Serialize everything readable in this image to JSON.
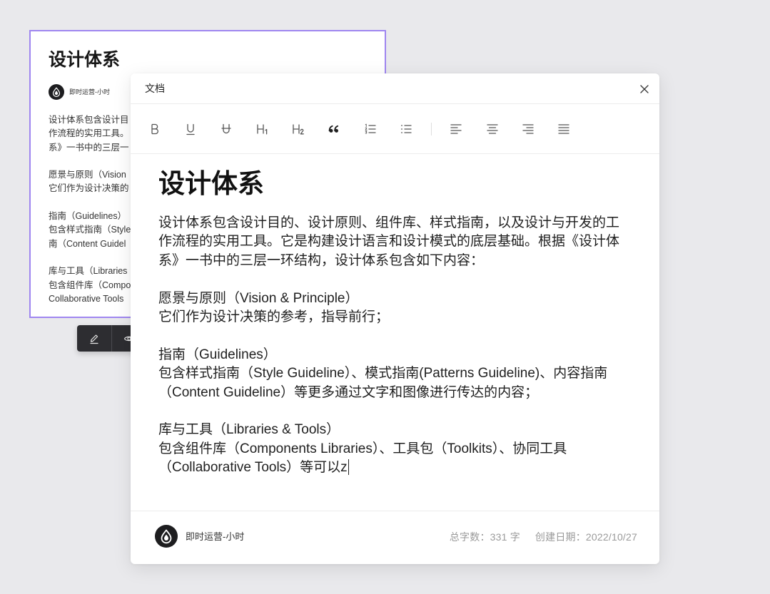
{
  "background_card": {
    "title": "设计体系",
    "author": "即时运营-小时",
    "avatar_icon": "droplet-logo-icon",
    "paragraphs": [
      [
        "设计体系包含设计目",
        "作流程的实用工具。",
        "系》一书中的三层一"
      ],
      [
        "愿景与原则（Vision",
        "它们作为设计决策的"
      ],
      [
        "指南（Guidelines）",
        "包含样式指南（Style",
        "南（Content Guidel"
      ],
      [
        "库与工具（Libraries",
        "包含组件库（Compo",
        "Collaborative Tools"
      ]
    ],
    "actions": [
      {
        "icon": "pencil-icon"
      },
      {
        "icon": "eye-icon"
      }
    ]
  },
  "modal": {
    "title": "文档",
    "close_icon": "close-icon",
    "toolbar": [
      {
        "icon": "bold-icon"
      },
      {
        "icon": "underline-icon"
      },
      {
        "icon": "strikethrough-icon"
      },
      {
        "icon": "heading-1-icon"
      },
      {
        "icon": "heading-2-icon"
      },
      {
        "icon": "blockquote-icon"
      },
      {
        "icon": "ordered-list-icon"
      },
      {
        "icon": "unordered-list-icon"
      },
      {
        "icon": "align-left-icon"
      },
      {
        "icon": "align-center-icon"
      },
      {
        "icon": "align-right-icon"
      },
      {
        "icon": "align-justify-icon"
      }
    ],
    "document": {
      "title": "设计体系",
      "paragraphs": [
        [
          "设计体系包含设计目的、设计原则、组件库、样式指南，以及设计与开发的工",
          "作流程的实用工具。它是构建设计语言和设计模式的底层基础。根据《设计体",
          "系》一书中的三层一环结构，设计体系包含如下内容："
        ],
        [
          "愿景与原则（Vision & Principle）",
          "它们作为设计决策的参考，指导前行；"
        ],
        [
          "指南（Guidelines）",
          "包含样式指南（Style Guideline）、模式指南(Patterns Guideline)、内容指南",
          "（Content Guideline）等更多通过文字和图像进行传达的内容；"
        ],
        [
          "库与工具（Libraries & Tools）",
          "包含组件库（Components Libraries）、工具包（Toolkits）、协同工具",
          "（Collaborative Tools）等可以z"
        ]
      ]
    },
    "footer": {
      "author": "即时运营-小时",
      "avatar_icon": "droplet-logo-icon",
      "word_count_label": "总字数：",
      "word_count_value": "331 字",
      "created_label": "创建日期：",
      "created_value": "2022/10/27"
    }
  },
  "colors": {
    "page_background": "#e9e9ec",
    "card_border": "#9f86f0",
    "action_bar": "#2d2d31",
    "text_primary": "#1f1f1f",
    "text_muted": "#9a9a9a"
  }
}
